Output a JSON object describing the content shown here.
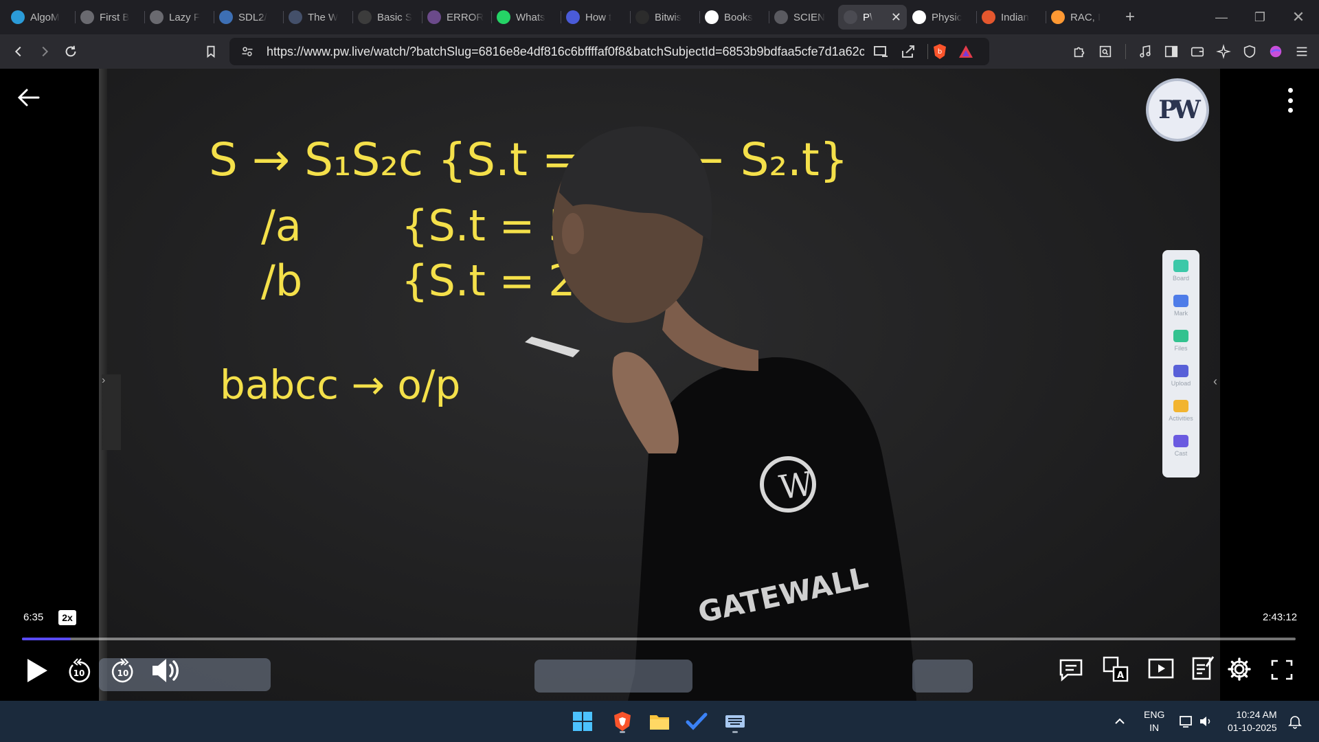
{
  "browser": {
    "tabs": [
      {
        "label": "AlgoM",
        "icon": "globe-icon",
        "color": "#2b9bd8"
      },
      {
        "label": "First B",
        "icon": "globe-icon",
        "color": "#6a6a70"
      },
      {
        "label": "Lazy F",
        "icon": "globe-icon",
        "color": "#6a6a70"
      },
      {
        "label": "SDL2/",
        "icon": "globe-icon",
        "color": "#3d6fb4"
      },
      {
        "label": "The W",
        "icon": "wikipedia-icon",
        "color": "#44506a"
      },
      {
        "label": "Basic S",
        "icon": "doc-icon",
        "color": "#3c3c3c"
      },
      {
        "label": "ERROR",
        "icon": "globe-icon",
        "color": "#6b4a8a"
      },
      {
        "label": "Whats",
        "icon": "whatsapp-icon",
        "color": "#25d366"
      },
      {
        "label": "How t",
        "icon": "bookmark-icon",
        "color": "#4a5bd8"
      },
      {
        "label": "Bitwis",
        "icon": "cp-icon",
        "color": "#2c2c2c"
      },
      {
        "label": "Books",
        "icon": "google-icon",
        "color": "#ffffff"
      },
      {
        "label": "SCIEN",
        "icon": "globe-icon",
        "color": "#5a5a60"
      },
      {
        "label": "P\\",
        "icon": "pw-icon",
        "color": "#4b4b52"
      },
      {
        "label": "Physic",
        "icon": "wikipedia-icon",
        "color": "#ffffff"
      },
      {
        "label": "Indian",
        "icon": "globe-icon",
        "color": "#e4572e"
      },
      {
        "label": "RAC, I",
        "icon": "flag-india-icon",
        "color": "#ff9933"
      }
    ],
    "active_tab_index": 12,
    "new_tab_label": "+",
    "url": "https://www.pw.live/watch/?batchSlug=6816e8e4df816c6bffffaf0f8&batchSubjectId=6853b9bdfaa5cfe7d1a62c0..."
  },
  "board": {
    "line1": "S → S₁S₂c {S.t = S₁.t − S₂.t}",
    "line2_left": "/a",
    "line2_right": "{S.t = 5}",
    "line3_left": "/b",
    "line3_right": "{S.t = 2}",
    "line4": "babcc → o/p",
    "shirt_text": "GATEWALL"
  },
  "logo": {
    "text": "PW"
  },
  "side_panel": {
    "items": [
      {
        "label": "Board",
        "color": "#3cc8a8"
      },
      {
        "label": "Mark",
        "color": "#4e7ce8"
      },
      {
        "label": "Files",
        "color": "#32c28f"
      },
      {
        "label": "Upload",
        "color": "#5860d8"
      },
      {
        "label": "Activities",
        "color": "#f2b430"
      },
      {
        "label": "Cast",
        "color": "#6a5ae0"
      }
    ]
  },
  "player": {
    "current_time": "6:35",
    "speed": "2x",
    "total_time": "2:43:12",
    "progress": 0.0384,
    "progress_color": "#5a4bff",
    "rewind_label": "10",
    "forward_label": "10"
  },
  "taskbar": {
    "lang_top": "ENG",
    "lang_bottom": "IN",
    "time": "10:24 AM",
    "date": "01-10-2025"
  }
}
